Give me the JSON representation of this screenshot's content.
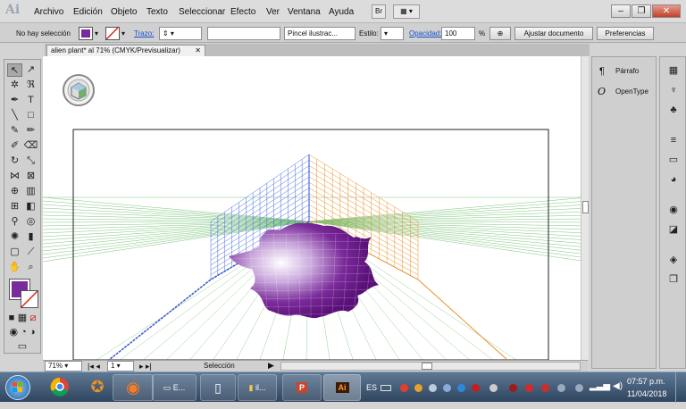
{
  "menubar": {
    "items": [
      "Archivo",
      "Edición",
      "Objeto",
      "Texto",
      "Seleccionar",
      "Efecto",
      "Ver",
      "Ventana",
      "Ayuda"
    ],
    "bridge": "Br"
  },
  "control": {
    "selection": "No hay selección",
    "stroke_label": "Trazo:",
    "brush": "Pincel ilustrac...",
    "style_label": "Estilo:",
    "opacity_label": "Opacidad:",
    "opacity": "100",
    "percent": "%",
    "doc_setup": "Ajustar documento",
    "prefs": "Preferencias"
  },
  "document": {
    "tab": "alien plant* al 71% (CMYK/Previsualizar)"
  },
  "status": {
    "zoom": "71%",
    "artboard": "1",
    "tool": "Selección"
  },
  "panels": {
    "paragraph": "Párrafo",
    "opentype": "OpenType"
  },
  "taskbar": {
    "lang": "ES",
    "time": "07:57 p.m.",
    "date": "11/04/2018",
    "e_label": "E...",
    "il_label": "il..."
  },
  "colors": {
    "fill": "#7a2a9a",
    "blue_grid": "#4a6fe0",
    "orange_grid": "#e8902a",
    "green_grid": "#7cc47a"
  }
}
